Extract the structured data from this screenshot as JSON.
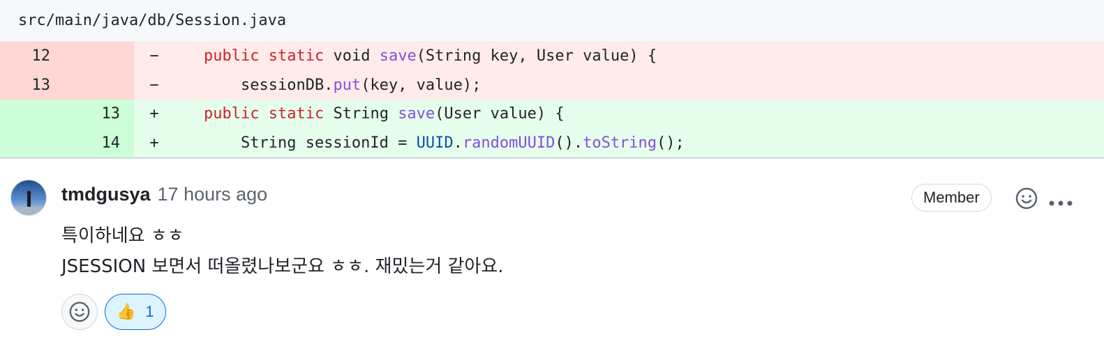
{
  "file": {
    "path": "src/main/java/db/Session.java"
  },
  "diff": {
    "rows": [
      {
        "type": "del",
        "old": "12",
        "new": "",
        "marker": "−",
        "tokens": [
          [
            "kw",
            "public"
          ],
          [
            "plain",
            " "
          ],
          [
            "kw",
            "static"
          ],
          [
            "plain",
            " void "
          ],
          [
            "fn",
            "save"
          ],
          [
            "plain",
            "(String key, User value) {"
          ]
        ]
      },
      {
        "type": "del",
        "old": "13",
        "new": "",
        "marker": "−",
        "tokens": [
          [
            "plain",
            "    sessionDB."
          ],
          [
            "fn",
            "put"
          ],
          [
            "plain",
            "(key, value);"
          ]
        ]
      },
      {
        "type": "add",
        "old": "",
        "new": "13",
        "marker": "+",
        "tokens": [
          [
            "kw",
            "public"
          ],
          [
            "plain",
            " "
          ],
          [
            "kw",
            "static"
          ],
          [
            "plain",
            " String "
          ],
          [
            "fn",
            "save"
          ],
          [
            "plain",
            "(User value) {"
          ]
        ]
      },
      {
        "type": "add",
        "old": "",
        "new": "14",
        "marker": "+",
        "tokens": [
          [
            "plain",
            "    String sessionId = "
          ],
          [
            "cls",
            "UUID"
          ],
          [
            "plain",
            "."
          ],
          [
            "fn",
            "randomUUID"
          ],
          [
            "plain",
            "()."
          ],
          [
            "fn",
            "toString"
          ],
          [
            "plain",
            "();"
          ]
        ]
      }
    ]
  },
  "comment": {
    "author": "tmdgusya",
    "time": "17 hours ago",
    "badge": "Member",
    "lines": [
      "특이하네요 ㅎㅎ",
      "JSESSION 보면서 떠올렸나보군요 ㅎㅎ. 재밌는거 같아요."
    ],
    "icons": {
      "react": "smiley-icon",
      "more": "kebab-horizontal-icon"
    },
    "reactions": [
      {
        "emoji": "👍",
        "count": "1"
      }
    ]
  },
  "colors": {
    "del_num_bg": "#ffd7d5",
    "del_code_bg": "#ffebe9",
    "add_num_bg": "#ccffd8",
    "add_code_bg": "#e6ffec",
    "keyword": "#cf222e",
    "function": "#8250df",
    "class": "#0550ae",
    "reaction_active": "#0969da"
  }
}
